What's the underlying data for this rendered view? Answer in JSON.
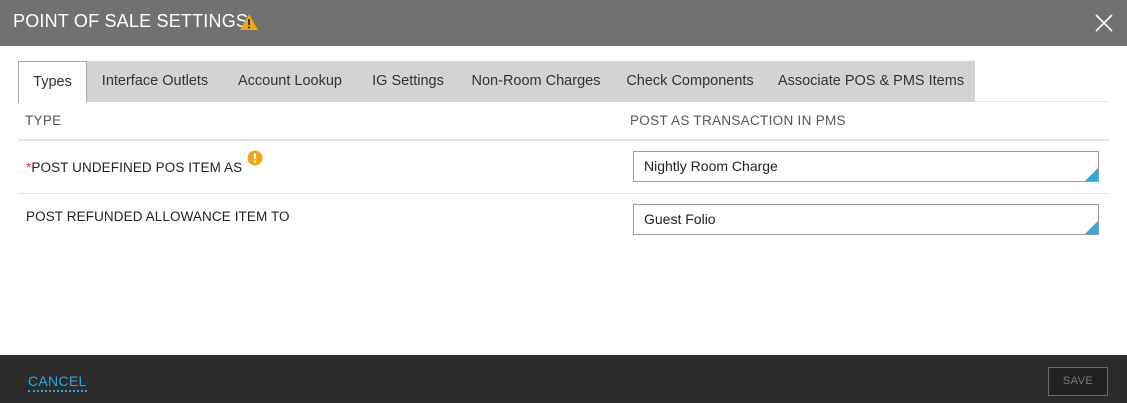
{
  "dialog": {
    "title": "POINT OF SALE SETTINGS",
    "warning_icon": "warning-triangle-icon",
    "close_icon": "close-icon"
  },
  "tabs": [
    {
      "label": "Types",
      "active": true
    },
    {
      "label": "Interface Outlets",
      "active": false
    },
    {
      "label": "Account Lookup",
      "active": false
    },
    {
      "label": "IG Settings",
      "active": false
    },
    {
      "label": "Non-Room Charges",
      "active": false
    },
    {
      "label": "Check Components",
      "active": false
    },
    {
      "label": "Associate POS & PMS Items",
      "active": false
    }
  ],
  "table": {
    "headers": {
      "type": "TYPE",
      "post_as": "POST AS TRANSACTION IN PMS"
    },
    "rows": [
      {
        "required_mark": "*",
        "label": "POST UNDEFINED POS ITEM AS",
        "value": "Nightly Room Charge",
        "info_icon": "info-alert-icon"
      },
      {
        "required_mark": "",
        "label": "POST REFUNDED ALLOWANCE ITEM TO",
        "value": "Guest Folio"
      }
    ]
  },
  "footer": {
    "cancel_label": "CANCEL",
    "save_label": "SAVE"
  },
  "colors": {
    "titlebar": "#717171",
    "accent": "#2ea8e0",
    "warning": "#f0a818",
    "required": "#d9302c",
    "footer": "#2b2b2b"
  }
}
